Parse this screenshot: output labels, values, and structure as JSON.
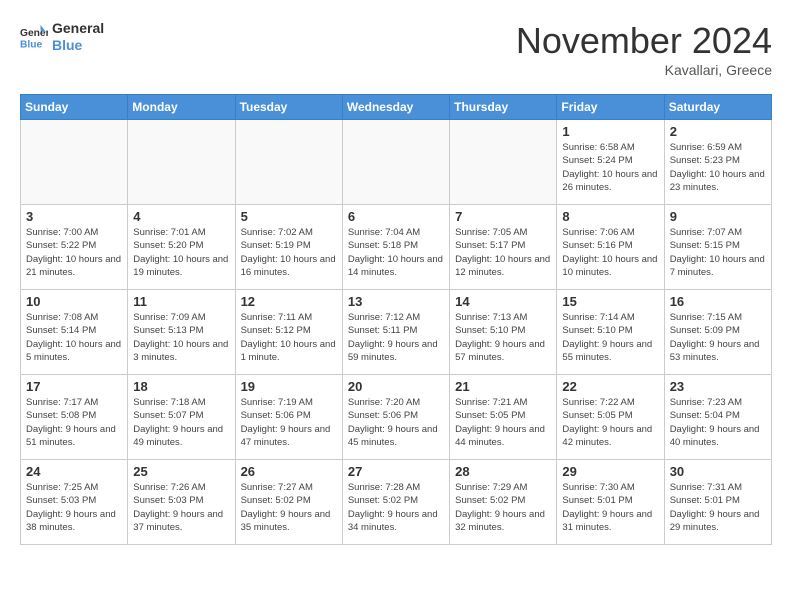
{
  "header": {
    "logo_line1": "General",
    "logo_line2": "Blue",
    "month": "November 2024",
    "location": "Kavallari, Greece"
  },
  "days_of_week": [
    "Sunday",
    "Monday",
    "Tuesday",
    "Wednesday",
    "Thursday",
    "Friday",
    "Saturday"
  ],
  "weeks": [
    [
      {
        "day": "",
        "info": ""
      },
      {
        "day": "",
        "info": ""
      },
      {
        "day": "",
        "info": ""
      },
      {
        "day": "",
        "info": ""
      },
      {
        "day": "",
        "info": ""
      },
      {
        "day": "1",
        "info": "Sunrise: 6:58 AM\nSunset: 5:24 PM\nDaylight: 10 hours and 26 minutes."
      },
      {
        "day": "2",
        "info": "Sunrise: 6:59 AM\nSunset: 5:23 PM\nDaylight: 10 hours and 23 minutes."
      }
    ],
    [
      {
        "day": "3",
        "info": "Sunrise: 7:00 AM\nSunset: 5:22 PM\nDaylight: 10 hours and 21 minutes."
      },
      {
        "day": "4",
        "info": "Sunrise: 7:01 AM\nSunset: 5:20 PM\nDaylight: 10 hours and 19 minutes."
      },
      {
        "day": "5",
        "info": "Sunrise: 7:02 AM\nSunset: 5:19 PM\nDaylight: 10 hours and 16 minutes."
      },
      {
        "day": "6",
        "info": "Sunrise: 7:04 AM\nSunset: 5:18 PM\nDaylight: 10 hours and 14 minutes."
      },
      {
        "day": "7",
        "info": "Sunrise: 7:05 AM\nSunset: 5:17 PM\nDaylight: 10 hours and 12 minutes."
      },
      {
        "day": "8",
        "info": "Sunrise: 7:06 AM\nSunset: 5:16 PM\nDaylight: 10 hours and 10 minutes."
      },
      {
        "day": "9",
        "info": "Sunrise: 7:07 AM\nSunset: 5:15 PM\nDaylight: 10 hours and 7 minutes."
      }
    ],
    [
      {
        "day": "10",
        "info": "Sunrise: 7:08 AM\nSunset: 5:14 PM\nDaylight: 10 hours and 5 minutes."
      },
      {
        "day": "11",
        "info": "Sunrise: 7:09 AM\nSunset: 5:13 PM\nDaylight: 10 hours and 3 minutes."
      },
      {
        "day": "12",
        "info": "Sunrise: 7:11 AM\nSunset: 5:12 PM\nDaylight: 10 hours and 1 minute."
      },
      {
        "day": "13",
        "info": "Sunrise: 7:12 AM\nSunset: 5:11 PM\nDaylight: 9 hours and 59 minutes."
      },
      {
        "day": "14",
        "info": "Sunrise: 7:13 AM\nSunset: 5:10 PM\nDaylight: 9 hours and 57 minutes."
      },
      {
        "day": "15",
        "info": "Sunrise: 7:14 AM\nSunset: 5:10 PM\nDaylight: 9 hours and 55 minutes."
      },
      {
        "day": "16",
        "info": "Sunrise: 7:15 AM\nSunset: 5:09 PM\nDaylight: 9 hours and 53 minutes."
      }
    ],
    [
      {
        "day": "17",
        "info": "Sunrise: 7:17 AM\nSunset: 5:08 PM\nDaylight: 9 hours and 51 minutes."
      },
      {
        "day": "18",
        "info": "Sunrise: 7:18 AM\nSunset: 5:07 PM\nDaylight: 9 hours and 49 minutes."
      },
      {
        "day": "19",
        "info": "Sunrise: 7:19 AM\nSunset: 5:06 PM\nDaylight: 9 hours and 47 minutes."
      },
      {
        "day": "20",
        "info": "Sunrise: 7:20 AM\nSunset: 5:06 PM\nDaylight: 9 hours and 45 minutes."
      },
      {
        "day": "21",
        "info": "Sunrise: 7:21 AM\nSunset: 5:05 PM\nDaylight: 9 hours and 44 minutes."
      },
      {
        "day": "22",
        "info": "Sunrise: 7:22 AM\nSunset: 5:05 PM\nDaylight: 9 hours and 42 minutes."
      },
      {
        "day": "23",
        "info": "Sunrise: 7:23 AM\nSunset: 5:04 PM\nDaylight: 9 hours and 40 minutes."
      }
    ],
    [
      {
        "day": "24",
        "info": "Sunrise: 7:25 AM\nSunset: 5:03 PM\nDaylight: 9 hours and 38 minutes."
      },
      {
        "day": "25",
        "info": "Sunrise: 7:26 AM\nSunset: 5:03 PM\nDaylight: 9 hours and 37 minutes."
      },
      {
        "day": "26",
        "info": "Sunrise: 7:27 AM\nSunset: 5:02 PM\nDaylight: 9 hours and 35 minutes."
      },
      {
        "day": "27",
        "info": "Sunrise: 7:28 AM\nSunset: 5:02 PM\nDaylight: 9 hours and 34 minutes."
      },
      {
        "day": "28",
        "info": "Sunrise: 7:29 AM\nSunset: 5:02 PM\nDaylight: 9 hours and 32 minutes."
      },
      {
        "day": "29",
        "info": "Sunrise: 7:30 AM\nSunset: 5:01 PM\nDaylight: 9 hours and 31 minutes."
      },
      {
        "day": "30",
        "info": "Sunrise: 7:31 AM\nSunset: 5:01 PM\nDaylight: 9 hours and 29 minutes."
      }
    ]
  ]
}
